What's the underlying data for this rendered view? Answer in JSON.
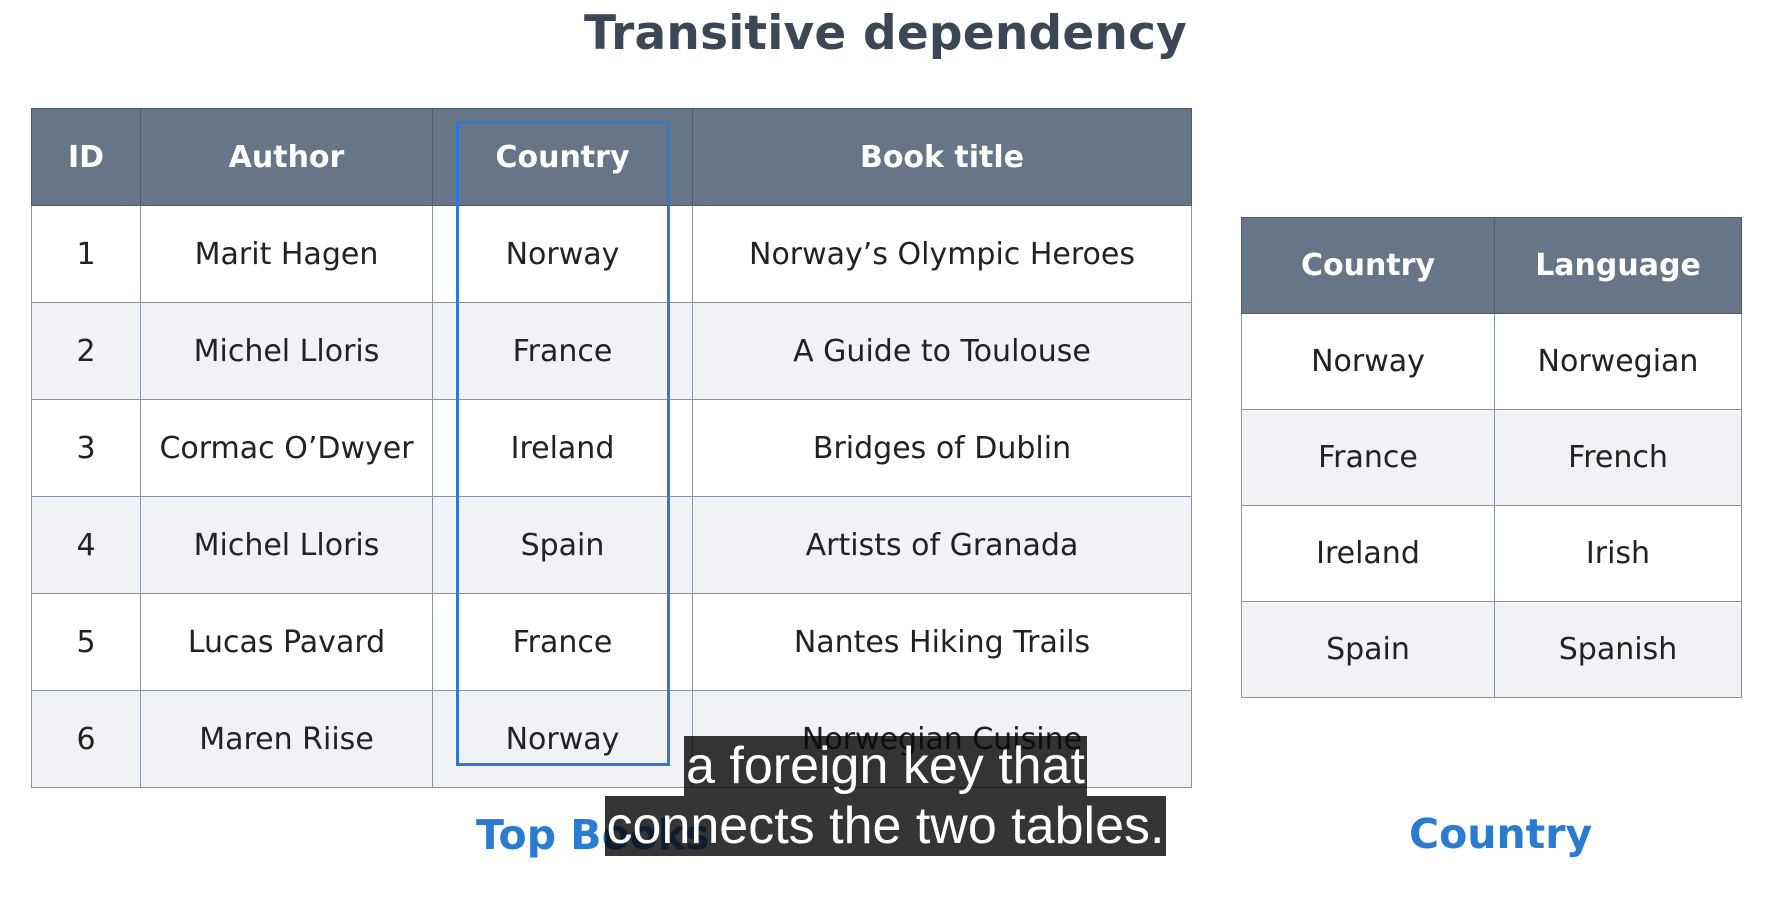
{
  "title": "Transitive dependency",
  "books_table": {
    "caption": "Top Books",
    "columns": [
      "ID",
      "Author",
      "Country",
      "Book title"
    ],
    "rows": [
      [
        "1",
        "Marit Hagen",
        "Norway",
        "Norway’s Olympic Heroes"
      ],
      [
        "2",
        "Michel Lloris",
        "France",
        "A Guide to Toulouse"
      ],
      [
        "3",
        "Cormac O’Dwyer",
        "Ireland",
        "Bridges of Dublin"
      ],
      [
        "4",
        "Michel Lloris",
        "Spain",
        "Artists of Granada"
      ],
      [
        "5",
        "Lucas Pavard",
        "France",
        "Nantes Hiking Trails"
      ],
      [
        "6",
        "Maren Riise",
        "Norway",
        "Norwegian Cuisine"
      ]
    ],
    "highlighted_column": "Country"
  },
  "country_table": {
    "caption": "Country",
    "columns": [
      "Country",
      "Language"
    ],
    "rows": [
      [
        "Norway",
        "Norwegian"
      ],
      [
        "France",
        "French"
      ],
      [
        "Ireland",
        "Irish"
      ],
      [
        "Spain",
        "Spanish"
      ]
    ]
  },
  "subtitles": {
    "line1": "a foreign key that",
    "line2": "connects the two tables."
  },
  "colors": {
    "header_bg": "#667587",
    "highlight_border": "#2f78d4",
    "caption_text": "#2b7bd0",
    "title_text": "#3c4654"
  }
}
